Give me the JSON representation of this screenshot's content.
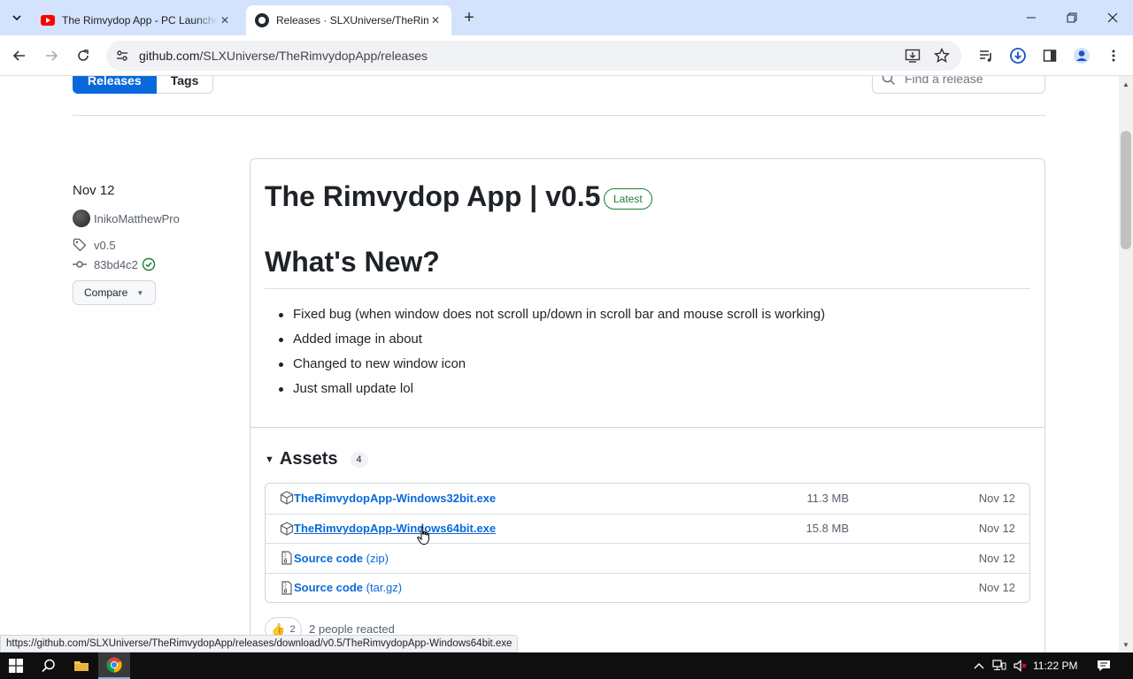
{
  "browser": {
    "tabs": [
      {
        "title": "The Rimvydop App - PC Launcher",
        "favicon": "youtube-icon",
        "active": false
      },
      {
        "title": "Releases · SLXUniverse/TheRimvydopApp",
        "favicon": "github-icon",
        "active": true
      }
    ],
    "new_tab_label": "+",
    "url_host": "github.com",
    "url_path": "/SLXUniverse/TheRimvydopApp/releases"
  },
  "subnav": {
    "releases_label": "Releases",
    "tags_label": "Tags",
    "find_placeholder": "Find a release"
  },
  "release": {
    "date": "Nov 12",
    "author": "InikoMatthewPro",
    "tag": "v0.5",
    "commit": "83bd4c2",
    "compare_label": "Compare",
    "title": "The Rimvydop App | v0.5",
    "latest_badge": "Latest",
    "notes_heading": "What's New?",
    "notes": [
      "Fixed bug (when window does not scroll up/down in scroll bar and mouse scroll is working)",
      "Added image in about",
      "Changed to new window icon",
      "Just small update lol"
    ],
    "assets_label": "Assets",
    "assets_count": "4",
    "assets": [
      {
        "name": "TheRimvydopApp-Windows32bit.exe",
        "suffix": "",
        "size": "11.3 MB",
        "date": "Nov 12",
        "icon": "package-icon"
      },
      {
        "name": "TheRimvydopApp-Windows64bit.exe",
        "suffix": "",
        "size": "15.8 MB",
        "date": "Nov 12",
        "icon": "package-icon"
      },
      {
        "name": "Source code",
        "suffix": "(zip)",
        "size": "",
        "date": "Nov 12",
        "icon": "file-zip-icon"
      },
      {
        "name": "Source code",
        "suffix": "(tar.gz)",
        "size": "",
        "date": "Nov 12",
        "icon": "file-zip-icon"
      }
    ],
    "reaction_count": "2",
    "reaction_text": "2 people reacted"
  },
  "status_bar_url": "https://github.com/SLXUniverse/TheRimvydopApp/releases/download/v0.5/TheRimvydopApp-Windows64bit.exe",
  "taskbar": {
    "clock": "11:22 PM"
  },
  "colors": {
    "accent": "#0969da",
    "latest": "#1a7f37",
    "tabstrip": "#d3e3fd"
  }
}
